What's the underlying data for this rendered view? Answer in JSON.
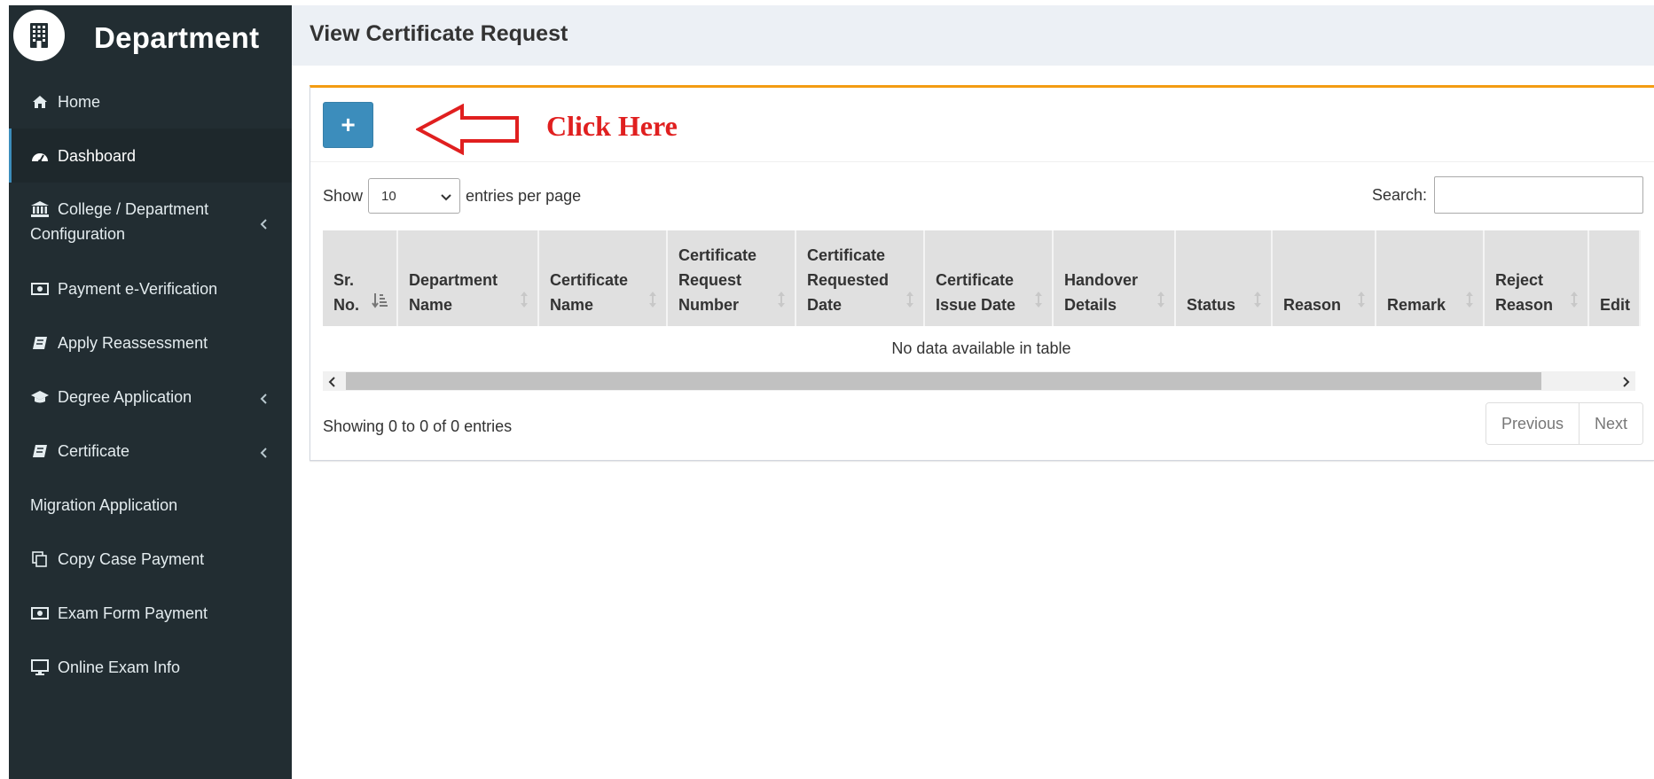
{
  "brand": {
    "title": "Department",
    "icon": "building-icon"
  },
  "sidebar": {
    "items": [
      {
        "label": "Home",
        "icon": "home-icon",
        "active": false,
        "has_submenu": false
      },
      {
        "label": "Dashboard",
        "icon": "dashboard-icon",
        "active": true,
        "has_submenu": false
      },
      {
        "label": "College / Department Configuration",
        "line1": "College / Department",
        "line2": "Configuration",
        "icon": "institution-icon",
        "active": false,
        "has_submenu": true
      },
      {
        "label": "Payment e-Verification",
        "icon": "money-icon",
        "active": false,
        "has_submenu": false
      },
      {
        "label": "Apply Reassessment",
        "icon": "book-icon",
        "active": false,
        "has_submenu": false
      },
      {
        "label": "Degree Application",
        "icon": "graduation-cap-icon",
        "active": false,
        "has_submenu": true
      },
      {
        "label": "Certificate",
        "icon": "book-icon",
        "active": false,
        "has_submenu": true
      },
      {
        "label": "Migration Application",
        "icon": "",
        "active": false,
        "has_submenu": false
      },
      {
        "label": "Copy Case Payment",
        "icon": "copy-icon",
        "active": false,
        "has_submenu": false
      },
      {
        "label": "Exam Form Payment",
        "icon": "money-icon",
        "active": false,
        "has_submenu": false
      },
      {
        "label": "Online Exam Info",
        "icon": "desktop-icon",
        "active": false,
        "has_submenu": false
      }
    ]
  },
  "header": {
    "title": "View Certificate Request"
  },
  "toolbar": {
    "add_label": "+",
    "annotation": "Click Here"
  },
  "table_controls": {
    "show_label": "Show",
    "page_length": "10",
    "entries_label": "entries per page",
    "search_label": "Search:",
    "search_value": ""
  },
  "table": {
    "columns": [
      {
        "line1": "",
        "line2": "Sr.",
        "line3": "No.",
        "sortable": true,
        "sorted": true
      },
      {
        "line1": "",
        "line2": "Department",
        "line3": "Name",
        "sortable": true,
        "sorted": false
      },
      {
        "line1": "",
        "line2": "Certificate",
        "line3": "Name",
        "sortable": true,
        "sorted": false
      },
      {
        "line1": "Certificate",
        "line2": "Request",
        "line3": "Number",
        "sortable": true,
        "sorted": false
      },
      {
        "line1": "Certificate",
        "line2": "Requested",
        "line3": "Date",
        "sortable": true,
        "sorted": false
      },
      {
        "line1": "",
        "line2": "Certificate",
        "line3": "Issue Date",
        "sortable": true,
        "sorted": false
      },
      {
        "line1": "",
        "line2": "Handover",
        "line3": "Details",
        "sortable": true,
        "sorted": false
      },
      {
        "line1": "",
        "line2": "",
        "line3": "Status",
        "sortable": true,
        "sorted": false
      },
      {
        "line1": "",
        "line2": "",
        "line3": "Reason",
        "sortable": true,
        "sorted": false
      },
      {
        "line1": "",
        "line2": "",
        "line3": "Remark",
        "sortable": true,
        "sorted": false
      },
      {
        "line1": "",
        "line2": "Reject",
        "line3": "Reason",
        "sortable": true,
        "sorted": false
      },
      {
        "line1": "",
        "line2": "",
        "line3": "Edit",
        "sortable": false,
        "sorted": false
      }
    ],
    "empty_message": "No data available in table"
  },
  "footer": {
    "info": "Showing 0 to 0 of 0 entries",
    "previous_label": "Previous",
    "next_label": "Next"
  },
  "colors": {
    "sidebar_bg": "#222d32",
    "active_item_bg": "#1e282c",
    "header_bg": "#ecf0f5",
    "primary_button": "#3c8dbc",
    "box_accent": "#f39c12",
    "annotation_red": "#e01f1f",
    "table_header_bg": "#e0e0e0"
  }
}
